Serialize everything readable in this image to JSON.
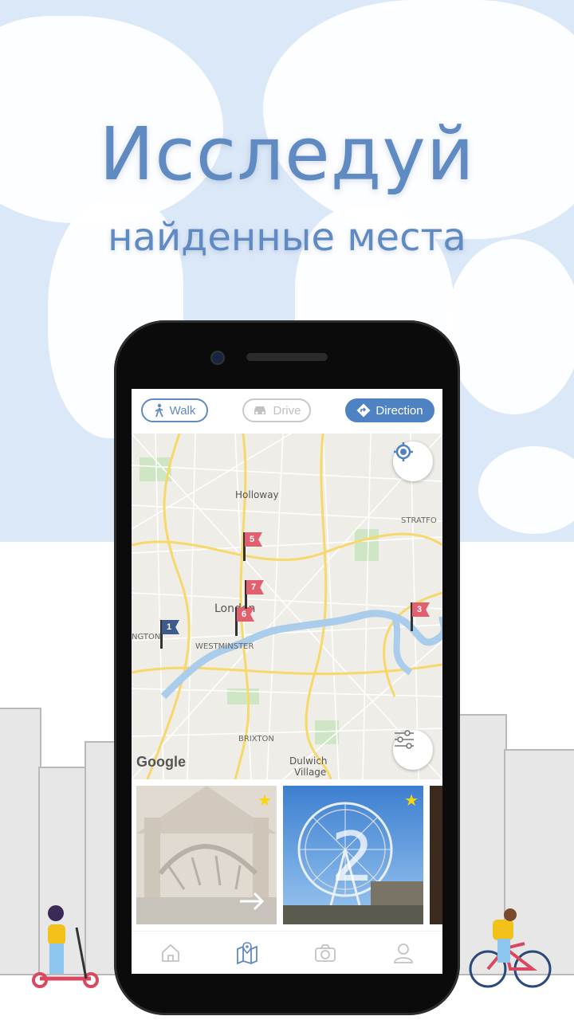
{
  "promo": {
    "headline": "Исследуй",
    "subline": "найденные места"
  },
  "mode_bar": {
    "walk_label": "Walk",
    "drive_label": "Drive",
    "direction_label": "Direction"
  },
  "map": {
    "labels": {
      "holloway": "Holloway",
      "stratford": "STRATFO",
      "london": "London",
      "westminster": "WESTMINSTER",
      "kensington": "NGTON",
      "brixton": "BRIXTON",
      "dulwich": "Dulwich",
      "village": "Village"
    },
    "attribution": "Google",
    "pins": [
      {
        "number": "1",
        "color": "#3e5a8a"
      },
      {
        "number": "3",
        "color": "#e0606f"
      },
      {
        "number": "5",
        "color": "#e0606f"
      },
      {
        "number": "6",
        "color": "#e0606f"
      },
      {
        "number": "7",
        "color": "#e0606f"
      }
    ]
  },
  "cards": [
    {
      "title": "museum hall",
      "starred": true
    },
    {
      "title": "london eye",
      "number": "2",
      "starred": true
    }
  ],
  "tabs": [
    "home-icon",
    "map-icon",
    "camera-icon",
    "profile-icon"
  ],
  "colors": {
    "accent": "#5f8ac2",
    "active": "#4f82c3",
    "pin_red": "#e0606f",
    "pin_blue": "#3e5a8a",
    "star": "#f7d60a"
  }
}
